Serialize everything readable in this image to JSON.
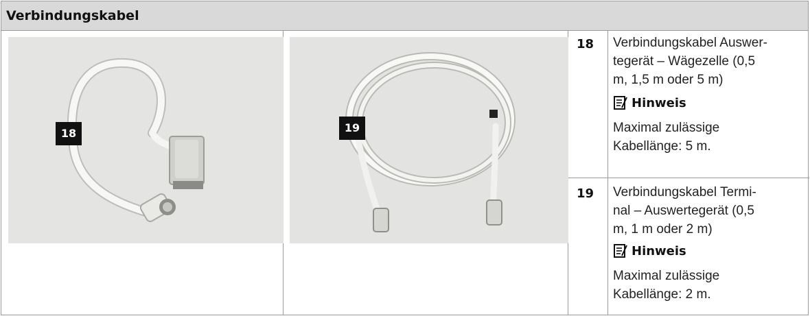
{
  "section": {
    "title": "Verbindungskabel"
  },
  "images": [
    {
      "callout": "18",
      "icon": "cable-with-connector-photo"
    },
    {
      "callout": "19",
      "icon": "coiled-cable-photo"
    }
  ],
  "items": [
    {
      "number": "18",
      "description_lines": [
        "Verbindungskabel Auswer-",
        "tegerät – Wägezelle (0,5",
        "m, 1,5 m oder 5 m)"
      ],
      "note_label": "Hinweis",
      "note_icon": "note-icon",
      "note_lines": [
        "Maximal zulässige",
        "Kabellänge: 5 m."
      ]
    },
    {
      "number": "19",
      "description_lines": [
        "Verbindungskabel Termi-",
        "nal – Auswertegerät (0,5",
        "m, 1 m oder 2 m)"
      ],
      "note_label": "Hinweis",
      "note_icon": "note-icon",
      "note_lines": [
        "Maximal zulässige",
        "Kabellänge: 2 m."
      ]
    }
  ]
}
